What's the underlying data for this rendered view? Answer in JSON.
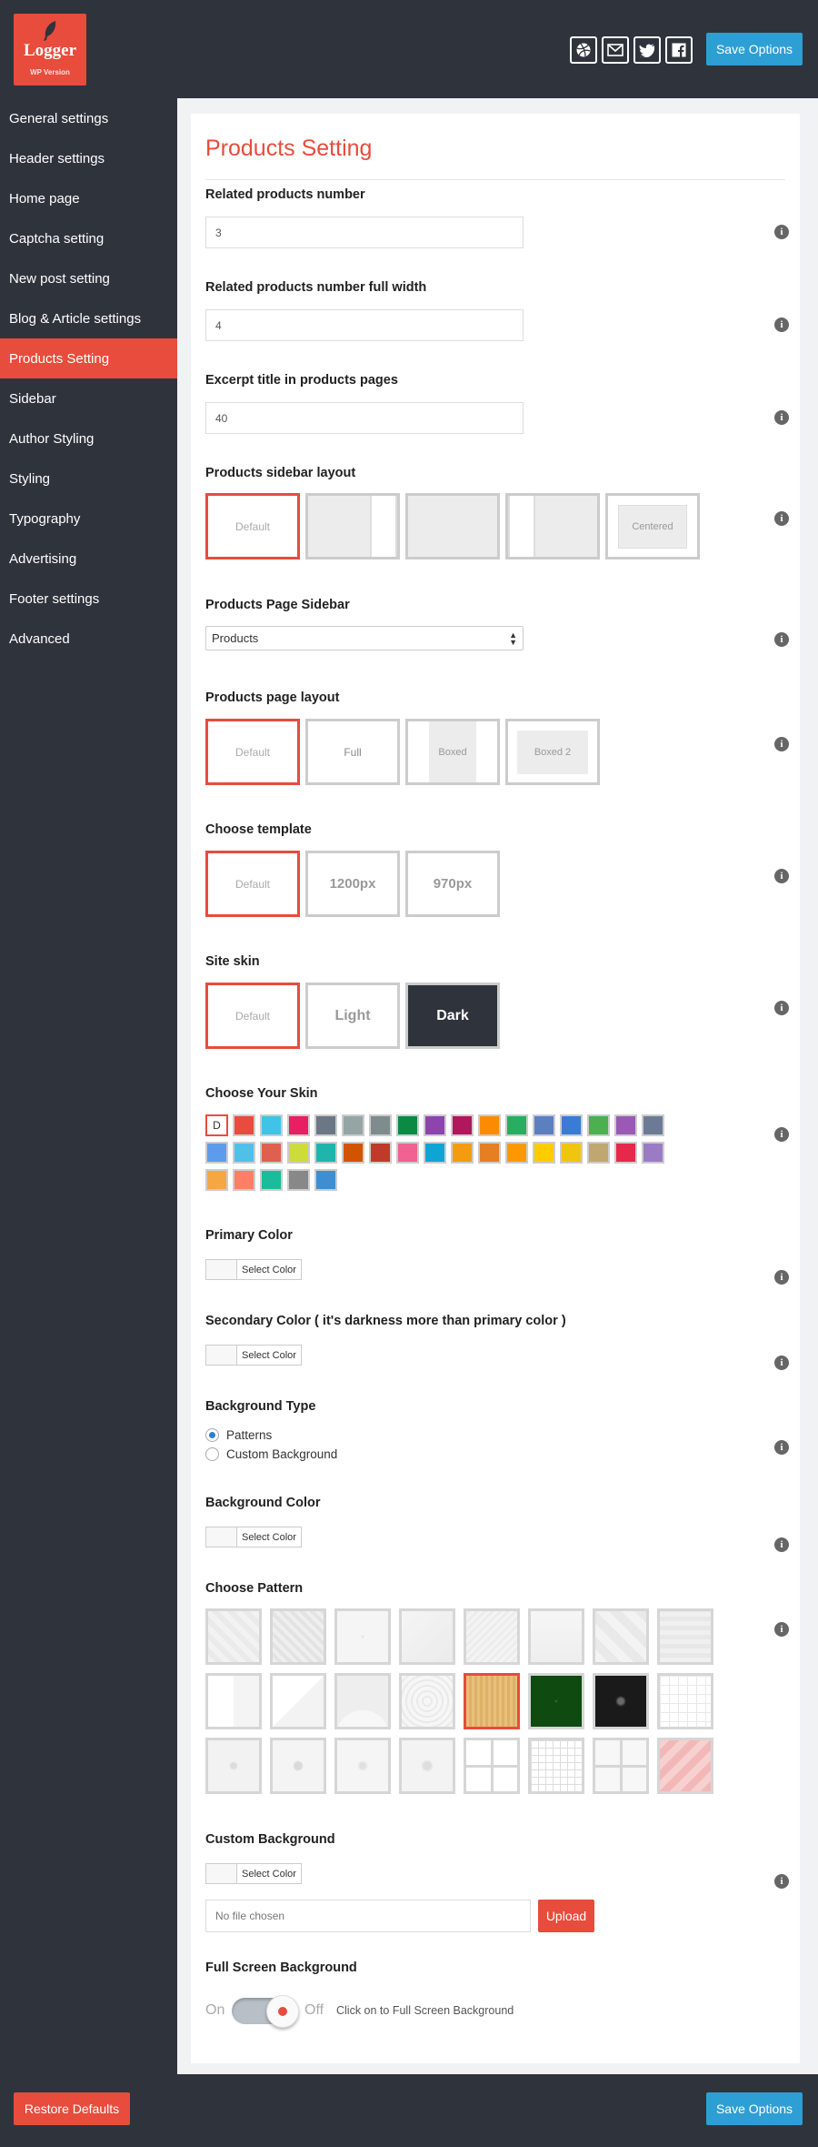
{
  "header": {
    "logo_name": "Logger",
    "logo_sub": "WP Version",
    "save_label": "Save Options",
    "social_icons": [
      "dribbble-icon",
      "mail-icon",
      "twitter-icon",
      "facebook-icon"
    ]
  },
  "sidebar": {
    "items": [
      {
        "label": "General settings",
        "active": false
      },
      {
        "label": "Header settings",
        "active": false
      },
      {
        "label": "Home page",
        "active": false
      },
      {
        "label": "Captcha setting",
        "active": false
      },
      {
        "label": "New post setting",
        "active": false
      },
      {
        "label": "Blog & Article settings",
        "active": false
      },
      {
        "label": "Products Setting",
        "active": true
      },
      {
        "label": "Sidebar",
        "active": false
      },
      {
        "label": "Author Styling",
        "active": false
      },
      {
        "label": "Styling",
        "active": false
      },
      {
        "label": "Typography",
        "active": false
      },
      {
        "label": "Advertising",
        "active": false
      },
      {
        "label": "Footer settings",
        "active": false
      },
      {
        "label": "Advanced",
        "active": false
      }
    ]
  },
  "panel": {
    "title": "Products Setting",
    "related_products": {
      "label": "Related products number",
      "value": "3"
    },
    "related_full": {
      "label": "Related products number full width",
      "value": "4"
    },
    "excerpt": {
      "label": "Excerpt title in products pages",
      "value": "40"
    },
    "sidebar_layout": {
      "label": "Products sidebar layout",
      "default_label": "Default",
      "centered_label": "Centered"
    },
    "page_sidebar": {
      "label": "Products Page Sidebar",
      "value": "Products"
    },
    "page_layout": {
      "label": "Products page layout",
      "options": [
        "Default",
        "Full",
        "Boxed",
        "Boxed 2"
      ]
    },
    "template": {
      "label": "Choose template",
      "options": [
        "Default",
        "1200px",
        "970px"
      ]
    },
    "site_skin": {
      "label": "Site skin",
      "options": [
        "Default",
        "Light",
        "Dark"
      ]
    },
    "skin": {
      "label": "Choose Your Skin",
      "default_letter": "D",
      "colors": [
        "#e74c3c",
        "#3fc4e8",
        "#e91e63",
        "#6b7785",
        "#95a5a6",
        "#7f8c8d",
        "#0b8a44",
        "#8e44ad",
        "#b0175d",
        "#fb8c00",
        "#27ae60",
        "#5b7fbf",
        "#3a7bd5",
        "#4caf50",
        "#9b59b6",
        "#6c7a96",
        "#5d9cec",
        "#4fc1e9",
        "#e0604f",
        "#cddc39",
        "#1fb5ad",
        "#d35400",
        "#c0392b",
        "#f06292",
        "#0ea5d6",
        "#f39c12",
        "#e67e22",
        "#ff9800",
        "#ffcc00",
        "#f1c40f",
        "#bfa76f",
        "#e6294b",
        "#9b7cc4",
        "#f5a742",
        "#ff7f66",
        "#1abc9c",
        "#888888",
        "#3d8fd1"
      ]
    },
    "primary_color": {
      "label": "Primary Color",
      "button": "Select Color"
    },
    "secondary_color": {
      "label": "Secondary Color ( it's darkness more than primary color )",
      "button": "Select Color"
    },
    "background_type": {
      "label": "Background Type",
      "options": [
        "Patterns",
        "Custom Background"
      ],
      "selected": "Patterns"
    },
    "background_color": {
      "label": "Background Color",
      "button": "Select Color"
    },
    "pattern": {
      "label": "Choose Pattern",
      "count": 24,
      "selected_index": 12
    },
    "custom_background": {
      "label": "Custom Background",
      "button": "Select Color",
      "file_placeholder": "No file chosen",
      "upload_label": "Upload"
    },
    "full_screen": {
      "label": "Full Screen Background",
      "on": "On",
      "off": "Off",
      "hint": "Click on to Full Screen Background",
      "value": "Off"
    }
  },
  "footer": {
    "restore_label": "Restore Defaults",
    "save_label": "Save Options"
  }
}
